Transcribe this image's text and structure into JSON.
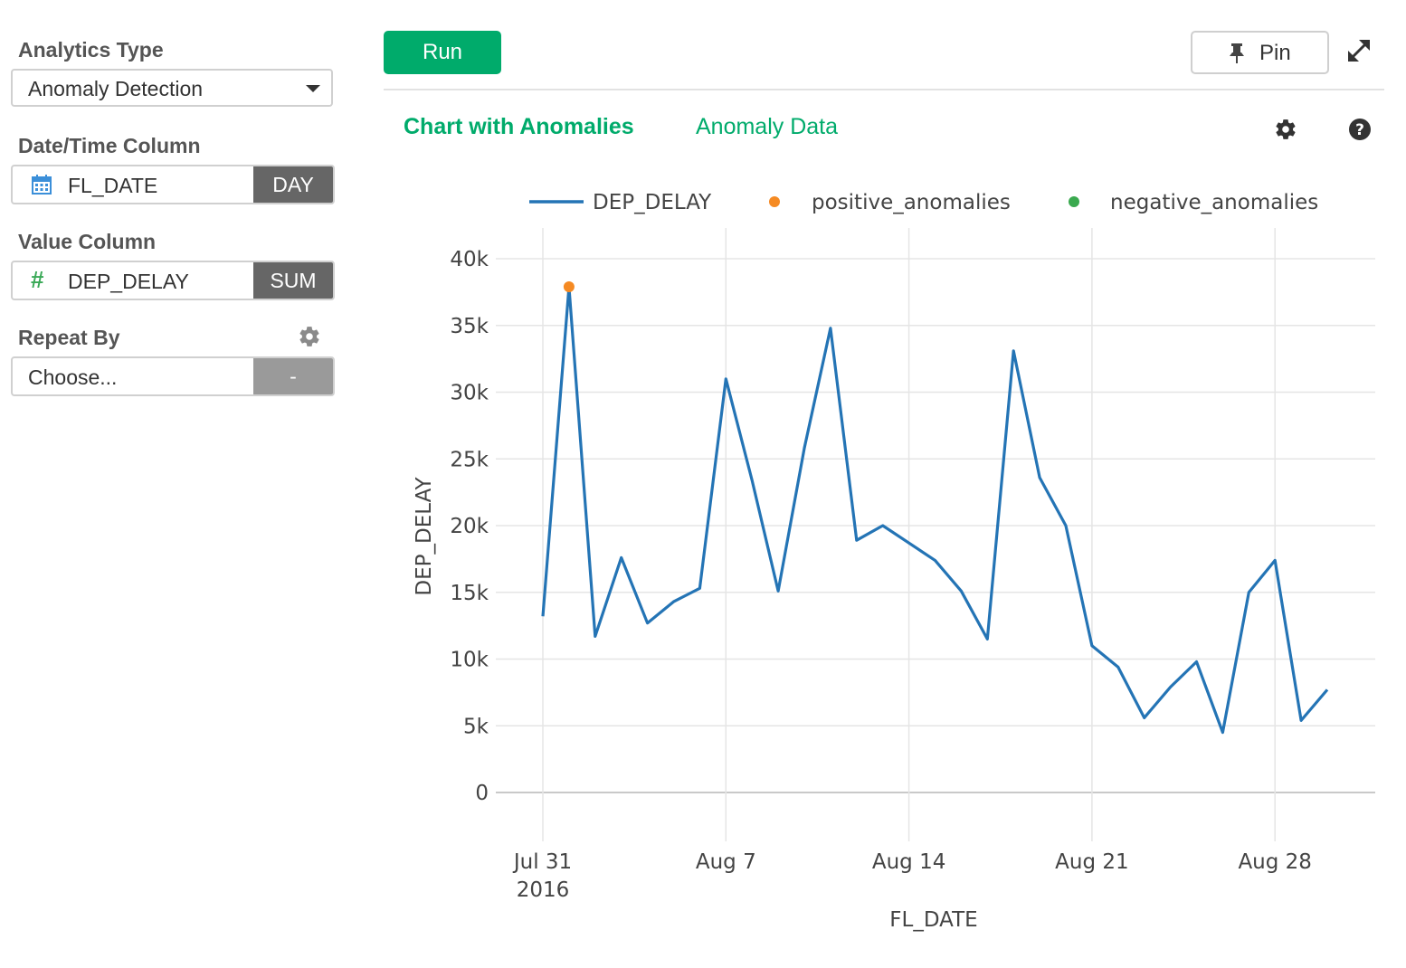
{
  "sidebar": {
    "analytics_type_label": "Analytics Type",
    "analytics_type_value": "Anomaly Detection",
    "datetime_label": "Date/Time Column",
    "datetime_value": "FL_DATE",
    "datetime_agg": "DAY",
    "value_label": "Value Column",
    "value_value": "DEP_DELAY",
    "value_agg": "SUM",
    "repeat_label": "Repeat By",
    "repeat_value": "Choose...",
    "repeat_agg": "-"
  },
  "toolbar": {
    "run_label": "Run",
    "pin_label": "Pin"
  },
  "tabs": [
    {
      "label": "Chart with Anomalies",
      "active": true
    },
    {
      "label": "Anomaly Data",
      "active": false
    }
  ],
  "colors": {
    "accent": "#00ab6b",
    "line": "#2474b5",
    "positive": "#f58a23",
    "negative": "#3aa94f",
    "grid": "#e5e5e5"
  },
  "chart_data": {
    "type": "line",
    "xlabel": "FL_DATE",
    "ylabel": "DEP_DELAY",
    "ylim": [
      0,
      40000
    ],
    "yticks": [
      0,
      5000,
      10000,
      15000,
      20000,
      25000,
      30000,
      35000,
      40000
    ],
    "ytick_labels": [
      "0",
      "5k",
      "10k",
      "15k",
      "20k",
      "25k",
      "30k",
      "35k",
      "40k"
    ],
    "xtick_labels": [
      {
        "date": "2016-07-31",
        "lines": [
          "Jul 31",
          "2016"
        ]
      },
      {
        "date": "2016-08-07",
        "lines": [
          "Aug 7"
        ]
      },
      {
        "date": "2016-08-14",
        "lines": [
          "Aug 14"
        ]
      },
      {
        "date": "2016-08-21",
        "lines": [
          "Aug 21"
        ]
      },
      {
        "date": "2016-08-28",
        "lines": [
          "Aug 28"
        ]
      }
    ],
    "legend": [
      "DEP_DELAY",
      "positive_anomalies",
      "negative_anomalies"
    ],
    "legend_position": "top",
    "grid": true,
    "series": [
      {
        "name": "DEP_DELAY",
        "x": [
          "2016-07-31",
          "2016-08-01",
          "2016-08-02",
          "2016-08-03",
          "2016-08-04",
          "2016-08-05",
          "2016-08-06",
          "2016-08-07",
          "2016-08-08",
          "2016-08-09",
          "2016-08-10",
          "2016-08-11",
          "2016-08-12",
          "2016-08-13",
          "2016-08-14",
          "2016-08-15",
          "2016-08-16",
          "2016-08-17",
          "2016-08-18",
          "2016-08-19",
          "2016-08-20",
          "2016-08-21",
          "2016-08-22",
          "2016-08-23",
          "2016-08-24",
          "2016-08-25",
          "2016-08-26",
          "2016-08-27",
          "2016-08-28",
          "2016-08-29",
          "2016-08-30"
        ],
        "values": [
          13200,
          37900,
          11700,
          17600,
          12700,
          14300,
          15300,
          31000,
          23400,
          15100,
          25800,
          34800,
          18900,
          20000,
          18700,
          17400,
          15100,
          11500,
          33100,
          23600,
          20000,
          11000,
          9400,
          5600,
          7900,
          9800,
          4500,
          15000,
          17400,
          5400,
          7700
        ]
      },
      {
        "name": "positive_anomalies",
        "x": [
          "2016-08-01"
        ],
        "values": [
          37900
        ]
      },
      {
        "name": "negative_anomalies",
        "x": [],
        "values": []
      }
    ]
  }
}
